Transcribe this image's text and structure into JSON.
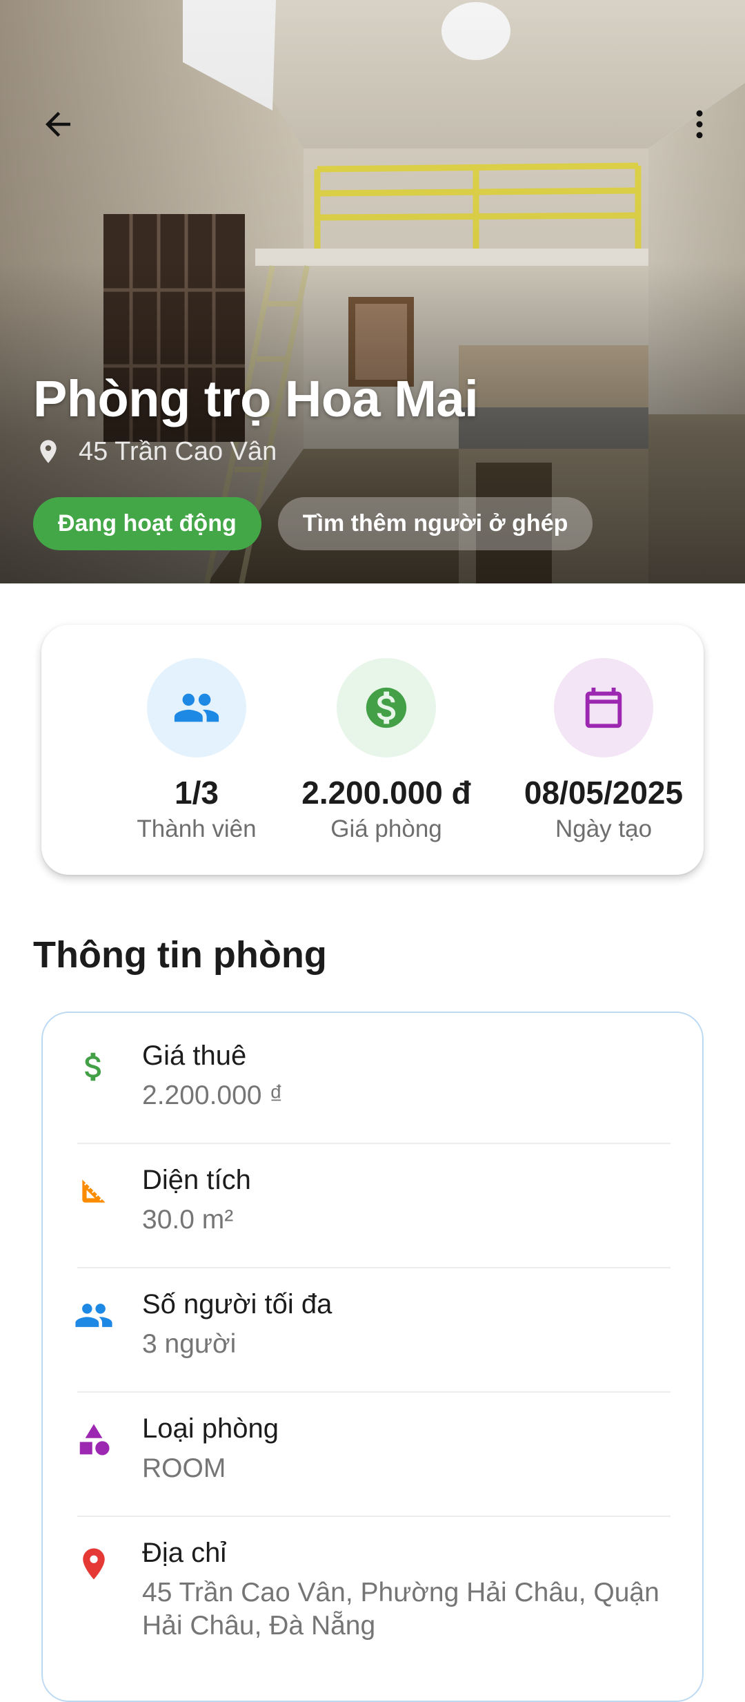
{
  "header": {
    "back_icon": "arrow-back-icon",
    "menu_icon": "more-vert-icon"
  },
  "hero": {
    "title": "Phòng trọ Hoa Mai",
    "address": "45 Trần Cao Vân",
    "chips": {
      "status": "Đang hoạt động",
      "roommate": "Tìm thêm người ở ghép"
    }
  },
  "stats": {
    "members": {
      "value": "1/3",
      "label": "Thành viên",
      "icon": "group-icon",
      "color": "#1e88e5"
    },
    "price": {
      "value": "2.200.000 đ",
      "label": "Giá phòng",
      "icon": "dollar-circle-icon",
      "color": "#43a047"
    },
    "date": {
      "value": "08/05/2025",
      "label": "Ngày tạo",
      "icon": "calendar-icon",
      "color": "#9c27b0"
    }
  },
  "room_info": {
    "title": "Thông tin phòng",
    "items": [
      {
        "label": "Giá thuê",
        "value": "2.200.000 ₫",
        "icon": "dollar-icon",
        "color": "#43a047"
      },
      {
        "label": "Diện tích",
        "value": "30.0 m²",
        "icon": "square-foot-icon",
        "color": "#fb8c00"
      },
      {
        "label": "Số người tối đa",
        "value": "3 người",
        "icon": "group-icon",
        "color": "#1e88e5"
      },
      {
        "label": "Loại phòng",
        "value": "ROOM",
        "icon": "category-icon",
        "color": "#9c27b0"
      },
      {
        "label": "Địa chỉ",
        "value": "45 Trần Cao Vân, Phường Hải Châu, Quận Hải Châu, Đà Nẵng",
        "icon": "location-pin-icon",
        "color": "#e53935"
      }
    ]
  }
}
